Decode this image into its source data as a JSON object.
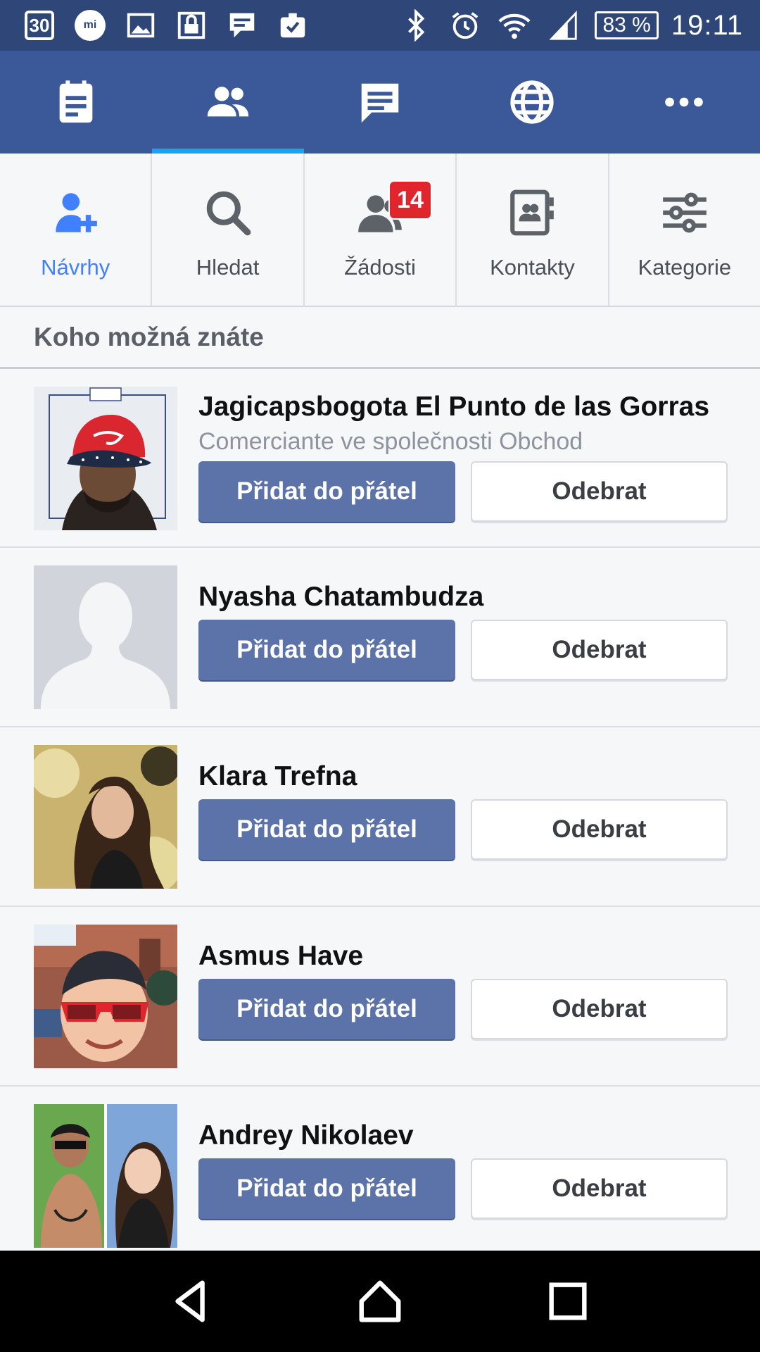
{
  "status_bar": {
    "calendar_day": "30",
    "mi_label": "mi",
    "left_icons": [
      "calendar-icon",
      "mi-icon",
      "image-icon",
      "lock-icon",
      "message-icon",
      "clipboard-icon"
    ],
    "right_icons": [
      "bluetooth-icon",
      "alarm-icon",
      "wifi-icon",
      "signal-icon"
    ],
    "battery": "83 %",
    "time": "19:11"
  },
  "top_nav": {
    "tabs": [
      {
        "icon": "news-feed-icon",
        "active": false
      },
      {
        "icon": "friends-icon",
        "active": true
      },
      {
        "icon": "messages-icon",
        "active": false
      },
      {
        "icon": "globe-icon",
        "active": false
      },
      {
        "icon": "more-icon",
        "active": false
      }
    ],
    "colors": {
      "bar": "#3b5998",
      "indicator": "#1aa2f5"
    }
  },
  "sub_nav": {
    "items": [
      {
        "label": "Návrhy",
        "icon": "add-friend-icon",
        "active": true
      },
      {
        "label": "Hledat",
        "icon": "search-icon",
        "active": false
      },
      {
        "label": "Žádosti",
        "icon": "friend-requests-icon",
        "active": false,
        "badge": "14"
      },
      {
        "label": "Kontakty",
        "icon": "contacts-icon",
        "active": false
      },
      {
        "label": "Kategorie",
        "icon": "sliders-icon",
        "active": false
      }
    ],
    "active_color": "#4080ff"
  },
  "section": {
    "title": "Koho možná znáte"
  },
  "suggestions": [
    {
      "name": "Jagicapsbogota El Punto de las Gorras",
      "subtitle": "Comerciante ve společnosti Obchod",
      "add_label": "Přidat do přátel",
      "remove_label": "Odebrat",
      "avatar": "cap-photo"
    },
    {
      "name": "Nyasha Chatambudza",
      "subtitle": "",
      "add_label": "Přidat do přátel",
      "remove_label": "Odebrat",
      "avatar": "default-silhouette"
    },
    {
      "name": "Klara Trefna",
      "subtitle": "",
      "add_label": "Přidat do přátel",
      "remove_label": "Odebrat",
      "avatar": "woman-photo"
    },
    {
      "name": "Asmus Have",
      "subtitle": "",
      "add_label": "Přidat do přátel",
      "remove_label": "Odebrat",
      "avatar": "sunglasses-photo"
    },
    {
      "name": "Andrey Nikolaev",
      "subtitle": "",
      "add_label": "Přidat do přátel",
      "remove_label": "Odebrat",
      "avatar": "couple-photo"
    }
  ],
  "android_nav": [
    "back-icon",
    "home-icon",
    "recents-icon"
  ]
}
